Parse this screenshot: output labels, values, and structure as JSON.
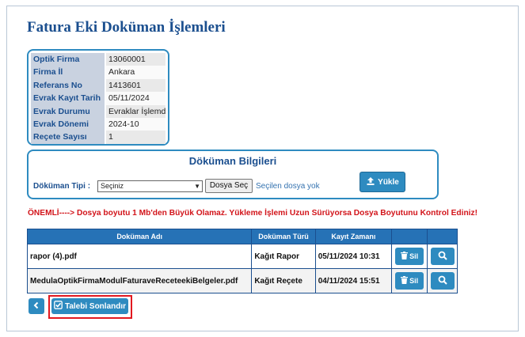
{
  "page": {
    "title": "Fatura Eki Doküman İşlemleri"
  },
  "info": [
    {
      "label": "Optik Firma",
      "value": "13060001"
    },
    {
      "label": "Firma İl",
      "value": "Ankara"
    },
    {
      "label": "Referans No",
      "value": "1413601"
    },
    {
      "label": "Evrak Kayıt Tarih",
      "value": "05/11/2024"
    },
    {
      "label": "Evrak Durumu",
      "value": "Evraklar İşlemde"
    },
    {
      "label": "Evrak Dönemi",
      "value": "2024-10"
    },
    {
      "label": "Reçete Sayısı",
      "value": "1"
    }
  ],
  "doc_section": {
    "title": "Döküman Bilgileri",
    "type_label": "Döküman Tipi :",
    "type_selected": "Seçiniz",
    "file_button": "Dosya Seç",
    "file_status": "Seçilen dosya yok",
    "upload_button": "Yükle"
  },
  "warning": "ÖNEMLİ----> Dosya boyutu 1 Mb'den Büyük Olamaz. Yükleme İşlemi Uzun Sürüyorsa Dosya Boyutunu Kontrol Ediniz!",
  "table": {
    "headers": [
      "Doküman Adı",
      "Doküman Türü",
      "Kayıt Zamanı",
      "",
      ""
    ],
    "rows": [
      {
        "name": "rapor (4).pdf",
        "type": "Kağıt Rapor",
        "time": "05/11/2024 10:31",
        "delete": "Sil"
      },
      {
        "name": "MedulaOptikFirmaModulFaturaveReceteekiBelgeler.pdf",
        "type": "Kağıt Reçete",
        "time": "04/11/2024 15:51",
        "delete": "Sil"
      }
    ]
  },
  "footer": {
    "finish_button": "Talebi Sonlandır"
  },
  "colors": {
    "accent": "#2e8bc0",
    "header": "#2672b6",
    "warning": "#d2141a",
    "highlight": "#e2181f"
  }
}
